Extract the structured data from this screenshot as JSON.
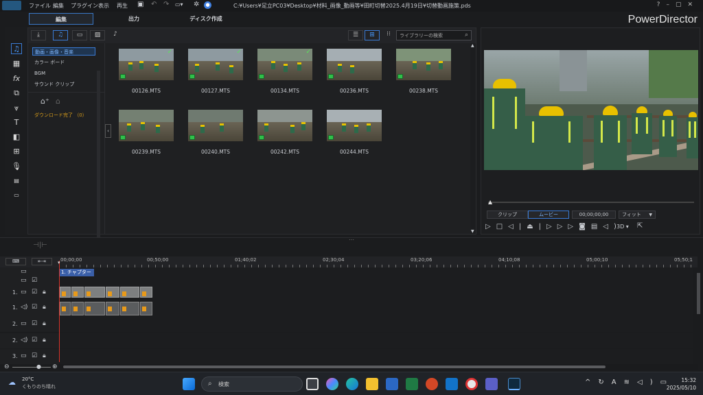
{
  "menu": {
    "items": [
      "ファイル",
      "編集",
      "プラグイン",
      "表示",
      "再生"
    ],
    "project_path": "C:¥Users¥足立PC03¥Desktop¥材料_画像_動画等¥田町切替2025.4月19日¥切替動画施策.pds"
  },
  "brand": "PowerDirector",
  "main_tabs": [
    "編集",
    "出力",
    "ディスク作成"
  ],
  "library": {
    "search_placeholder": "ライブラリーの検索",
    "categories": [
      "動画・画像・音楽",
      "カラー ボード",
      "BGM",
      "サウンド クリップ"
    ],
    "download_status": "ダウンロード完了 （0）",
    "clips": [
      {
        "name": "00126.MTS",
        "used": true
      },
      {
        "name": "00127.MTS",
        "used": true
      },
      {
        "name": "00134.MTS",
        "used": true
      },
      {
        "name": "00236.MTS",
        "used": false
      },
      {
        "name": "00238.MTS",
        "used": false
      },
      {
        "name": "00239.MTS",
        "used": false
      },
      {
        "name": "00240.MTS",
        "used": false
      },
      {
        "name": "00242.MTS",
        "used": false
      },
      {
        "name": "00244.MTS",
        "used": false
      }
    ]
  },
  "preview": {
    "clip_tab": "クリップ",
    "movie_tab": "ムービー",
    "timecode": "00;00;00;00",
    "fit": "フィット",
    "mode_3d": "3D"
  },
  "timeline": {
    "ruler_labels": [
      "00;00;00",
      "00;50;00",
      "01;40;02",
      "02;30;04",
      "03;20;06",
      "04;10;08",
      "05;00;10",
      "05;50;1"
    ],
    "chapter": "1. チャプター 1",
    "tracks": [
      {
        "num": "1.",
        "kind": "video"
      },
      {
        "num": "1.",
        "kind": "audio"
      },
      {
        "num": "2.",
        "kind": "video"
      },
      {
        "num": "2.",
        "kind": "audio"
      },
      {
        "num": "3.",
        "kind": "video"
      }
    ]
  },
  "taskbar": {
    "weather_temp": "20°C",
    "weather_desc": "くもりのち晴れ",
    "search_label": "検索",
    "time": "15:32",
    "date": "2025/05/10"
  },
  "colors": {
    "accent": "#3a7bd5",
    "playhead": "#d9342b",
    "chapter": "#3a5fa8"
  }
}
